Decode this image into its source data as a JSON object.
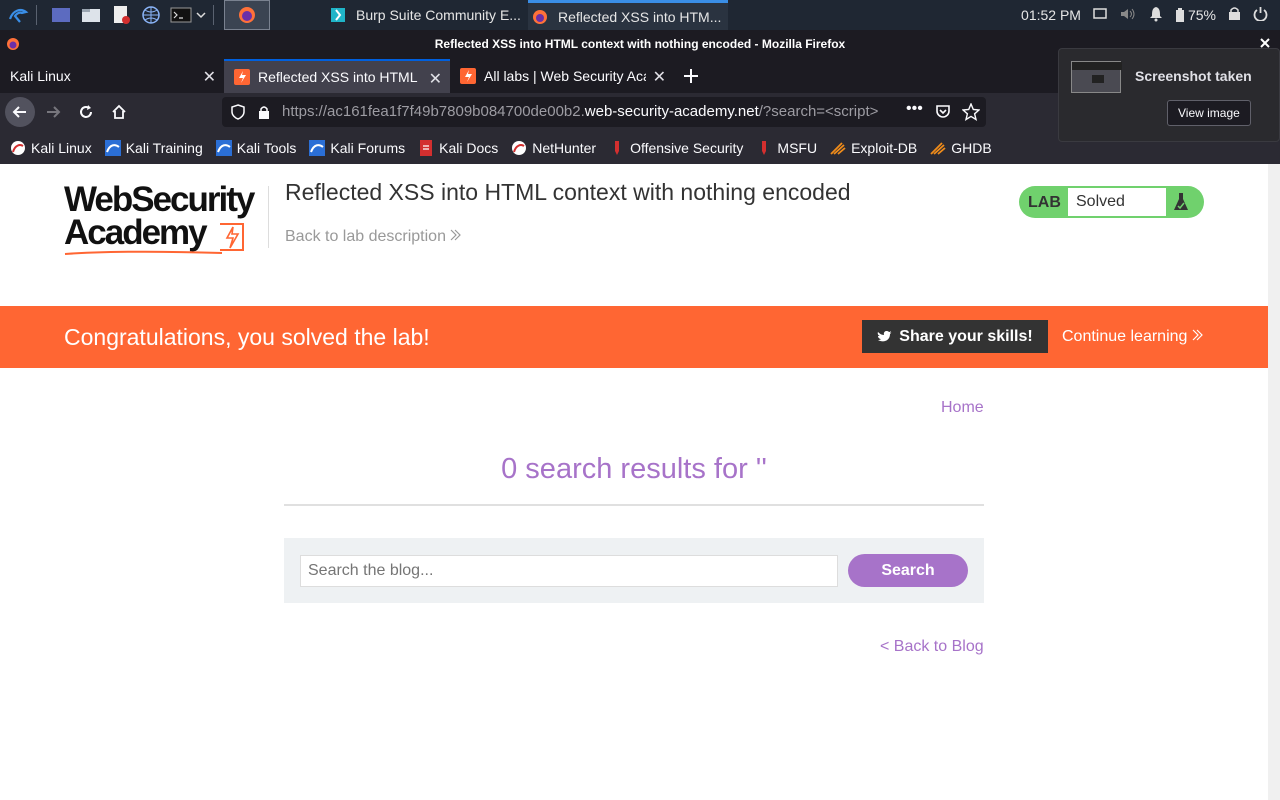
{
  "taskbar": {
    "tasks": [
      {
        "label": "Burp Suite Community E..."
      },
      {
        "label": "Reflected XSS into HTM..."
      }
    ],
    "clock": "01:52 PM",
    "battery": "75%"
  },
  "window": {
    "title": "Reflected XSS into HTML context with nothing encoded - Mozilla Firefox"
  },
  "tabs": [
    {
      "label": "Kali Linux"
    },
    {
      "label": "Reflected XSS into HTML context with nothing encoded"
    },
    {
      "label": "All labs | Web Security Academy"
    }
  ],
  "urlbar": {
    "prefix": "https://ac161fea1f7f49b7809b084700de00b2.",
    "domain": "web-security-academy.net",
    "suffix": "/?search=<script>"
  },
  "bookmarks": [
    {
      "label": "Kali Linux"
    },
    {
      "label": "Kali Training"
    },
    {
      "label": "Kali Tools"
    },
    {
      "label": "Kali Forums"
    },
    {
      "label": "Kali Docs"
    },
    {
      "label": "NetHunter"
    },
    {
      "label": "Offensive Security"
    },
    {
      "label": "MSFU"
    },
    {
      "label": "Exploit-DB"
    },
    {
      "label": "GHDB"
    }
  ],
  "notification": {
    "title": "Screenshot taken",
    "action": "View image"
  },
  "page": {
    "logo_line1": "WebSecurity",
    "logo_line2": "Academy",
    "lab_title": "Reflected XSS into HTML context with nothing encoded",
    "back_to_description": "Back to lab description",
    "lab_badge_label": "LAB",
    "lab_status": "Solved",
    "banner_message": "Congratulations, you solved the lab!",
    "share_button": "Share your skills!",
    "continue_link": "Continue learning",
    "home_link": "Home",
    "results_heading": "0 search results for ''",
    "search_placeholder": "Search the blog...",
    "search_button": "Search",
    "back_to_blog": "< Back to Blog"
  },
  "colors": {
    "banner": "#ff6633",
    "accent": "#a773c9",
    "lab_solved": "#70d16d"
  }
}
